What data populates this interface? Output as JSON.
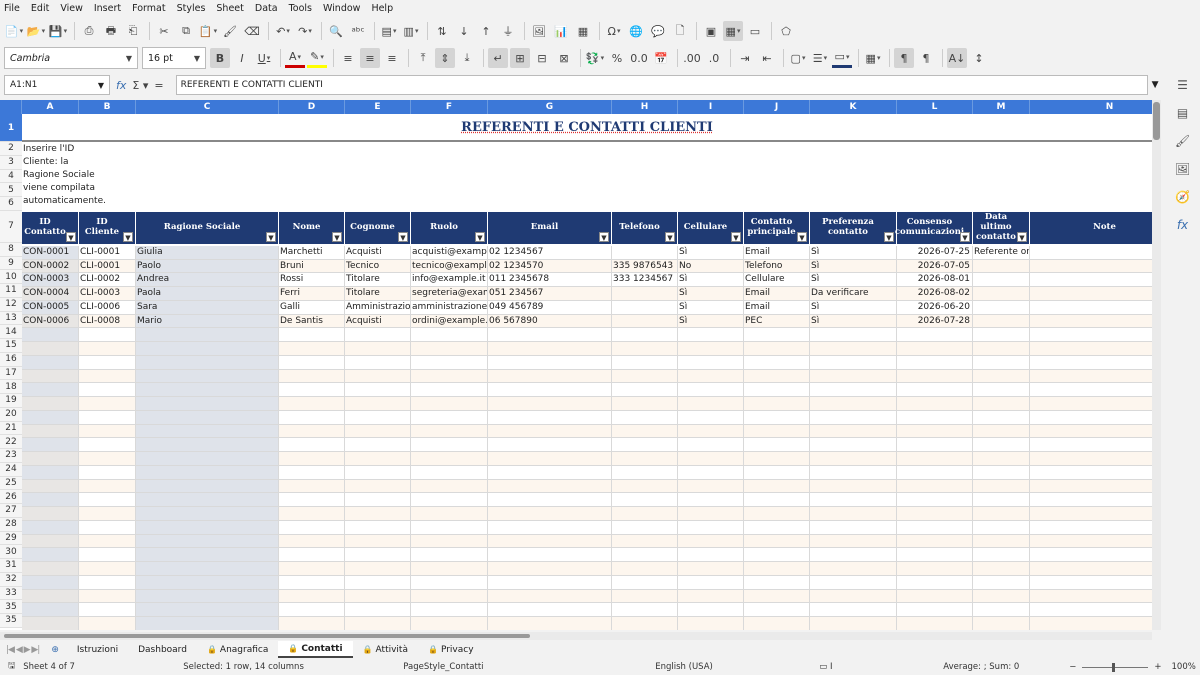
{
  "menu": [
    "File",
    "Edit",
    "View",
    "Insert",
    "Format",
    "Styles",
    "Sheet",
    "Data",
    "Tools",
    "Window",
    "Help"
  ],
  "format_toolbar": {
    "font_name": "Cambria",
    "font_size": "16 pt"
  },
  "formula_bar": {
    "name_box": "A1:N1",
    "content": "REFERENTI E CONTATTI CLIENTI"
  },
  "columns": [
    "A",
    "B",
    "C",
    "D",
    "E",
    "F",
    "G",
    "H",
    "I",
    "J",
    "K",
    "L",
    "M",
    "N"
  ],
  "row_numbers": [
    "1",
    "2",
    "3",
    "4",
    "5",
    "6",
    "7",
    "8",
    "9",
    "10",
    "11",
    "12",
    "13",
    "14",
    "15",
    "16",
    "17",
    "18",
    "19",
    "20",
    "21",
    "22",
    "23",
    "24",
    "25",
    "26",
    "27",
    "28",
    "29",
    "30",
    "31",
    "32",
    "33",
    "35",
    "35"
  ],
  "sheet": {
    "title": "REFERENTI E CONTATTI CLIENTI",
    "note": "Inserire l'ID Cliente: la Ragione Sociale viene compilata automaticamente.",
    "headers": [
      "ID Contatto",
      "ID Cliente",
      "Ragione Sociale",
      "Nome",
      "Cognome",
      "Ruolo",
      "Email",
      "Telefono",
      "Cellulare",
      "Contatto principale",
      "Preferenza contatto",
      "Consenso comunicazioni",
      "Data ultimo contatto",
      "Note"
    ],
    "rows": [
      [
        "CON-0001",
        "CLI-0001",
        "Giulia",
        "Marchetti",
        "Acquisti",
        "acquisti@example",
        "02 1234567",
        "",
        "Sì",
        "Email",
        "Sì",
        "2026-07-25",
        "Referente ordini",
        ""
      ],
      [
        "CON-0002",
        "CLI-0001",
        "Paolo",
        "Bruni",
        "Tecnico",
        "tecnico@example",
        "02 1234570",
        "335 9876543",
        "No",
        "Telefono",
        "Sì",
        "2026-07-05",
        "",
        ""
      ],
      [
        "CON-0003",
        "CLI-0002",
        "Andrea",
        "Rossi",
        "Titolare",
        "info@example.it",
        "011 2345678",
        "333 1234567",
        "Sì",
        "Cellulare",
        "Sì",
        "2026-08-01",
        "",
        ""
      ],
      [
        "CON-0004",
        "CLI-0003",
        "Paola",
        "Ferri",
        "Titolare",
        "segreteria@exam",
        "051 234567",
        "",
        "Sì",
        "Email",
        "Da verificare",
        "2026-08-02",
        "",
        ""
      ],
      [
        "CON-0005",
        "CLI-0006",
        "Sara",
        "Galli",
        "Amministrazior",
        "amministrazione@",
        "049 456789",
        "",
        "Sì",
        "Email",
        "Sì",
        "2026-06-20",
        "",
        ""
      ],
      [
        "CON-0006",
        "CLI-0008",
        "Mario",
        "De Santis",
        "Acquisti",
        "ordini@example.i",
        "06 567890",
        "",
        "Sì",
        "PEC",
        "Sì",
        "2026-07-28",
        "",
        ""
      ]
    ]
  },
  "tabs": [
    "Istruzioni",
    "Dashboard",
    "Anagrafica",
    "Contatti",
    "Attività",
    "Privacy"
  ],
  "active_tab": "Contatti",
  "status": {
    "sheet": "Sheet 4 of 7",
    "selection": "Selected: 1 row, 14 columns",
    "page_style": "PageStyle_Contatti",
    "language": "English (USA)",
    "sum": "Average: ; Sum: 0",
    "zoom": "100%"
  },
  "colors": {
    "header_blue": "#1f3a73",
    "col_header": "#3c78d8"
  }
}
